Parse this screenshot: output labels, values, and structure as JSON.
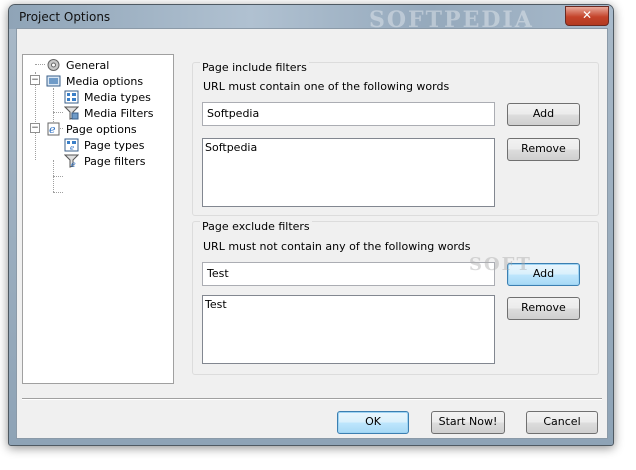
{
  "window": {
    "title": "Project Options",
    "close_glyph": "✕",
    "watermark": "SOFTPEDIA"
  },
  "tree": {
    "items": [
      {
        "label": "General",
        "icon": "gear-icon"
      },
      {
        "label": "Media options",
        "icon": "media-options-icon"
      },
      {
        "label": "Media types",
        "icon": "media-types-icon"
      },
      {
        "label": "Media Filters",
        "icon": "media-filters-icon"
      },
      {
        "label": "Page options",
        "icon": "page-options-icon"
      },
      {
        "label": "Page types",
        "icon": "page-types-icon"
      },
      {
        "label": "Page filters",
        "icon": "page-filters-icon",
        "selected": true
      }
    ],
    "collapse_glyph": "−"
  },
  "include": {
    "group_title": "Page include filters",
    "label": "URL must contain one of the following words",
    "input_value": "Softpedia",
    "list_items": [
      "Softpedia"
    ],
    "add_label": "Add",
    "remove_label": "Remove"
  },
  "exclude": {
    "group_title": "Page exclude filters",
    "label": "URL must not contain any of the following words",
    "input_value": "Test",
    "list_items": [
      "Test"
    ],
    "add_label": "Add",
    "remove_label": "Remove",
    "watermark": "SOFT"
  },
  "footer": {
    "ok_label": "OK",
    "start_label": "Start Now!",
    "cancel_label": "Cancel"
  }
}
